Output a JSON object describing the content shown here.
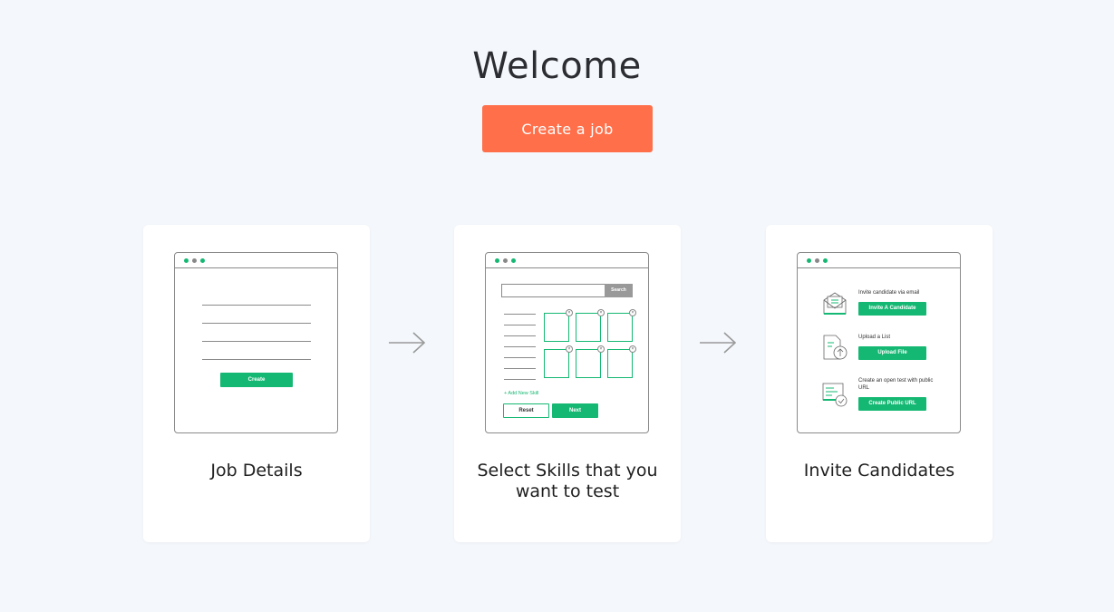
{
  "page": {
    "title": "Welcome",
    "cta_label": "Create a job"
  },
  "colors": {
    "accent": "#ff6f4a",
    "green": "#15b873",
    "background": "#f4f7fb"
  },
  "steps": [
    {
      "label": "Job Details",
      "mock": {
        "create_label": "Create"
      }
    },
    {
      "label": "Select Skills that you want to test",
      "mock": {
        "search_label": "Search",
        "add_skill_label": "+ Add New Skill",
        "reset_label": "Reset",
        "next_label": "Next"
      }
    },
    {
      "label": "Invite Candidates",
      "mock": {
        "email_text": "Invite candidate via email",
        "email_button": "Invite A Candidate",
        "list_text": "Upload a List",
        "list_button": "Upload File",
        "url_text": "Create an open test with public URL",
        "url_button": "Create Public URL"
      }
    }
  ],
  "icons": [
    "arrow-right-icon",
    "envelope-icon",
    "file-upload-icon",
    "public-url-icon"
  ]
}
